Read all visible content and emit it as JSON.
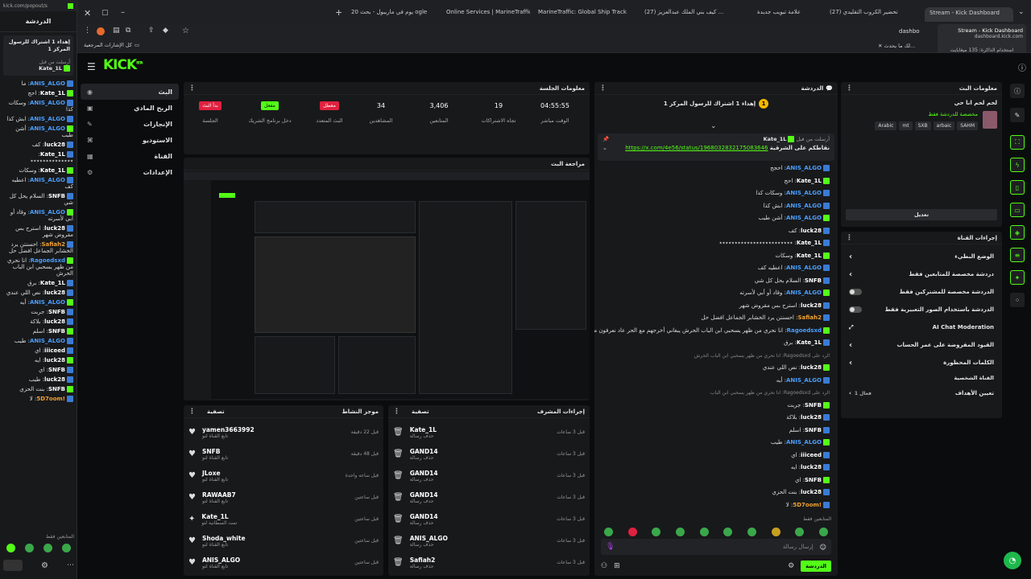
{
  "popout": {
    "url": "kick.com/popout/s",
    "title": "الدردشة",
    "pinned": "إهداء 1 اشتراك للرسول المركز 1",
    "pinned_by": "أرسلت من قبل",
    "pinned_user": "Kate_1L",
    "pinned_text": "نقاطكم على الشرقية",
    "messages": [
      {
        "user": "ANIS_ALGO",
        "text": "ما",
        "color": "blue"
      },
      {
        "user": "Kate_1L",
        "text": "احج",
        "color": "white"
      },
      {
        "user": "ANIS_ALGO",
        "text": "وسكات كذا",
        "color": "blue"
      },
      {
        "user": "ANIS_ALGO",
        "text": "ابش كذا",
        "color": "blue"
      },
      {
        "user": "ANIS_ALGO",
        "text": "أشن طيب",
        "color": "blue"
      },
      {
        "user": "luck28",
        "text": "كف",
        "color": "white"
      },
      {
        "user": "Kate_1L",
        "text": "٭٭٭٭٭٭٭٭٭٭٭٭٭٭",
        "color": "white"
      },
      {
        "user": "Kate_1L",
        "text": "وسكات",
        "color": "white"
      },
      {
        "user": "ANIS_ALGO",
        "text": "اعطيه كف",
        "color": "blue"
      },
      {
        "user": "SNFB",
        "text": "السلام يحل كل شي",
        "color": "white"
      },
      {
        "user": "ANIS_ALGO",
        "text": "وقاد أو أبي لأسرته",
        "color": "blue"
      },
      {
        "user": "luck28",
        "text": "استرح بس مقروض شهر",
        "color": "white"
      },
      {
        "user": "Safiah2",
        "text": "احسنتن يرد الخشابر الجماعل افضل حل",
        "color": "orange"
      },
      {
        "user": "Ragoedsxd",
        "text": "انا نحري من ظهر يسحبي ابن الباب الحرش",
        "color": "blue"
      },
      {
        "user": "Kate_1L",
        "text": "برق",
        "color": "white"
      },
      {
        "user": "luck28",
        "text": "نص اللي عندي",
        "color": "white"
      },
      {
        "user": "ANIS_ALGO",
        "text": "أيه",
        "color": "blue"
      },
      {
        "user": "SNFB",
        "text": "جربت",
        "color": "white"
      },
      {
        "user": "luck28",
        "text": "بلاكة",
        "color": "white"
      },
      {
        "user": "SNFB",
        "text": "اسلم",
        "color": "white"
      },
      {
        "user": "ANIS_ALGO",
        "text": "طيب",
        "color": "blue"
      },
      {
        "user": "iiiceed",
        "text": "اي",
        "color": "white"
      },
      {
        "user": "luck28",
        "text": "ايه",
        "color": "white"
      },
      {
        "user": "SNFB",
        "text": "اي",
        "color": "white"
      },
      {
        "user": "luck28",
        "text": "طيب",
        "color": "white"
      },
      {
        "user": "SNFB",
        "text": "بنت الحزي",
        "color": "white"
      },
      {
        "user": "!5D7oom",
        "text": "لا",
        "color": "orange"
      }
    ],
    "footer": "المتابعين فقط"
  },
  "browser": {
    "tabs": [
      {
        "label": "Stream - Kick Dashboard",
        "active": true
      },
      {
        "label": "تحضير الكروب التقليدي (27)"
      },
      {
        "label": "علامة تبويب جديدة"
      },
      {
        "label": "(27) كيف بني الملك عبدالعزيز ..."
      },
      {
        "label": "MarineTraffic: Global Ship Track"
      },
      {
        "label": "Online Services | MarineTraffic"
      },
      {
        "label": "20 يوم في ماريبول - بحث ogle"
      }
    ],
    "address": "dashbo",
    "bookmarks_label": "كل الإشارات المرجعية",
    "tooltip_title": "Stream - Kick Dashboard",
    "tooltip_url": "dashboard.kick.com",
    "tooltip_mem": "استخدام الذاكرة: 135 ميغابايت",
    "notice": "لك ما يحدث..."
  },
  "kick": {
    "logo": "KICK",
    "logo_sup": "BETA",
    "nav": [
      {
        "label": "البث",
        "icon": "live-icon"
      },
      {
        "label": "الربح المادي",
        "icon": "money-icon"
      },
      {
        "label": "الإنجازات",
        "icon": "trophy-icon"
      },
      {
        "label": "الاستوديو",
        "icon": "studio-icon"
      },
      {
        "label": "القناة",
        "icon": "channel-icon"
      },
      {
        "label": "الإعدادات",
        "icon": "settings-icon"
      }
    ],
    "session": {
      "title": "معلومات الجلسة",
      "stats": [
        {
          "label": "الوقت مباشر",
          "value": "04:55:55"
        },
        {
          "label": "تجاه الاشتراكات",
          "value": "19"
        },
        {
          "label": "المتابعين",
          "value": "3,406"
        },
        {
          "label": "المشاهدين",
          "value": "34"
        },
        {
          "label": "البث المتعدد",
          "value": "معطل",
          "badge": "red"
        },
        {
          "label": "دخل برنامج الشريك",
          "value": "مفعل",
          "badge": "green"
        },
        {
          "label": "الجلسة",
          "value": "بدأ البث",
          "badge": "red"
        }
      ]
    },
    "preview_title": "مراجعة البث",
    "activity": {
      "title": "موجز النشاط",
      "filter": "تصفية",
      "items": [
        {
          "name": "yamen3663992",
          "sub": "تابع القناة لتو",
          "time": "قبل 22 دقيقة",
          "icon": "heart-icon"
        },
        {
          "name": "SNFB",
          "sub": "تابع القناة لتو",
          "time": "قبل 48 دقيقة",
          "icon": "heart-icon"
        },
        {
          "name": "JLoxe",
          "sub": "تابع القناة لتو",
          "time": "قبل ساعة واحدة",
          "icon": "heart-icon"
        },
        {
          "name": "RAWAAB7",
          "sub": "تابع القناة لتو",
          "time": "قبل ساعتين",
          "icon": "heart-icon"
        },
        {
          "name": "Kate_1L",
          "sub": "تمت السطانية لتو",
          "time": "قبل ساعتين",
          "icon": "star-icon"
        },
        {
          "name": "Shoda_white",
          "sub": "تابع القناة لتو",
          "time": "قبل ساعتين",
          "icon": "heart-icon"
        },
        {
          "name": "ANIS_ALGO",
          "sub": "تابع القناة لتو",
          "time": "قبل ساعتين",
          "icon": "heart-icon"
        }
      ]
    },
    "modactions": {
      "title": "إجراءات المشرف",
      "filter": "تصفية",
      "items": [
        {
          "name": "Kate_1L",
          "sub": "حذف رسالة",
          "time": "قبل 3 ساعات"
        },
        {
          "name": "GAND14",
          "sub": "حذف رسالة",
          "time": "قبل 3 ساعات"
        },
        {
          "name": "GAND14",
          "sub": "حذف رسالة",
          "time": "قبل 3 ساعات"
        },
        {
          "name": "GAND14",
          "sub": "حذف رسالة",
          "time": "قبل 3 ساعات"
        },
        {
          "name": "GAND14",
          "sub": "حذف رسالة",
          "time": "قبل 3 ساعات"
        },
        {
          "name": "ANIS_ALGO",
          "sub": "حذف رسالة",
          "time": "قبل 3 ساعات"
        },
        {
          "name": "Safiah2",
          "sub": "حذف رسالة",
          "time": "قبل 3 ساعات"
        }
      ]
    },
    "chat": {
      "title": "الدردشة",
      "pinned": "إهداء 1 اشتراك للرسول المركز 1",
      "pinned_by": "أرسلت من قبل",
      "pinned_user": "Kate_1L",
      "pinned_text": "نقاطكم على الشرقية",
      "pinned_link": "https://x.com/4e56/status/1968032832175083646",
      "messages": [
        {
          "user": "ANIS_ALGO",
          "text": "احجج",
          "color": "blue"
        },
        {
          "user": "Kate_1L",
          "text": "احج",
          "color": "white"
        },
        {
          "user": "ANIS_ALGO",
          "text": "وسكات كذا",
          "color": "blue"
        },
        {
          "user": "ANIS_ALGO",
          "text": "ابش كذا",
          "color": "blue"
        },
        {
          "user": "ANIS_ALGO",
          "text": "أشن طيب",
          "color": "blue"
        },
        {
          "user": "luck28",
          "text": "كف",
          "color": "white"
        },
        {
          "user": "Kate_1L",
          "text": "٭٭٭٭٭٭٭٭٭٭٭٭٭٭٭٭٭٭٭٭٭٭٭٭",
          "color": "white"
        },
        {
          "user": "Kate_1L",
          "text": "وسكات",
          "color": "white"
        },
        {
          "user": "ANIS_ALGO",
          "text": "اعطيه كف",
          "color": "blue"
        },
        {
          "user": "SNFB",
          "text": "السلام يحل كل شي",
          "color": "white"
        },
        {
          "user": "ANIS_ALGO",
          "text": "وقاد أو أبي لأسرته",
          "color": "blue"
        },
        {
          "user": "luck28",
          "text": "استرح بس مقروض شهر",
          "color": "white"
        },
        {
          "user": "Safiah2",
          "text": "احسنتن يرد الخشابر الجماعل افضل حل",
          "color": "orange"
        },
        {
          "user": "Ragoedsxd",
          "text": "انا نحري من ظهر يسحبي ابن الباب الحرش يبغاني أخرجهم مع الحر عاد نعرفون من مكة عاد",
          "color": "blue"
        },
        {
          "user": "Kate_1L",
          "text": "برق",
          "color": "white"
        },
        {
          "user": "",
          "text": "الرد على Ragoedsxd: انا نحري من ظهر يسحبي ابن الباب الحرش",
          "color": "white"
        },
        {
          "user": "luck28",
          "text": "نص اللي عندي",
          "color": "white"
        },
        {
          "user": "ANIS_ALGO",
          "text": "أيه",
          "color": "blue"
        },
        {
          "user": "",
          "text": "الرد على Ragoedsxd: انا نحري من ظهر يسحبي ابن الباب",
          "color": "white"
        },
        {
          "user": "SNFB",
          "text": "جربت",
          "color": "white"
        },
        {
          "user": "luck28",
          "text": "بلاكة",
          "color": "white"
        },
        {
          "user": "SNFB",
          "text": "اسلم",
          "color": "white"
        },
        {
          "user": "ANIS_ALGO",
          "text": "طيب",
          "color": "blue"
        },
        {
          "user": "iiiceed",
          "text": "اي",
          "color": "white"
        },
        {
          "user": "luck28",
          "text": "ايه",
          "color": "white"
        },
        {
          "user": "SNFB",
          "text": "اي",
          "color": "white"
        },
        {
          "user": "luck28",
          "text": "بنت الحزي",
          "color": "white"
        },
        {
          "user": "!5D7oom",
          "text": "لا",
          "color": "orange"
        }
      ],
      "mode": "المتابعين فقط",
      "input_placeholder": "إرسال رسالة",
      "send_label": "الدردشة"
    },
    "streaminfo": {
      "title": "معلومات البث",
      "stream_title": "لحم لحم انا حي",
      "category": "مخصصة للدردشة فقط",
      "tags": [
        "Arabic",
        "mt",
        "SXB",
        "arbaic",
        "SAHM"
      ],
      "edit_label": "تعديل"
    },
    "channel": {
      "title": "إجراءات القناة",
      "rows": [
        {
          "label": "الوضع البطيء",
          "control": "chevron"
        },
        {
          "label": "دردشة مخصصة للمتابعين فقط",
          "control": "chevron"
        },
        {
          "label": "الدردشة مخصصة للمشتركين فقط",
          "control": "toggle"
        },
        {
          "label": "الدردشة باستخدام الصور التعبيرية فقط",
          "control": "toggle"
        },
        {
          "label": "AI Chat Moderation",
          "control": "icon"
        },
        {
          "label": "القيود المفروضة على عمر الحساب",
          "control": "chevron"
        },
        {
          "label": "الكلمات المحظورة",
          "control": "chevron"
        }
      ],
      "section": "القناة الشخصية",
      "goals_label": "تعيين الأهداف",
      "goals_value": "فعال 1"
    }
  },
  "colors": {
    "accent": "#53fc18",
    "bg": "#0b0c0d",
    "panel": "#18191b",
    "red": "#e0213f"
  }
}
